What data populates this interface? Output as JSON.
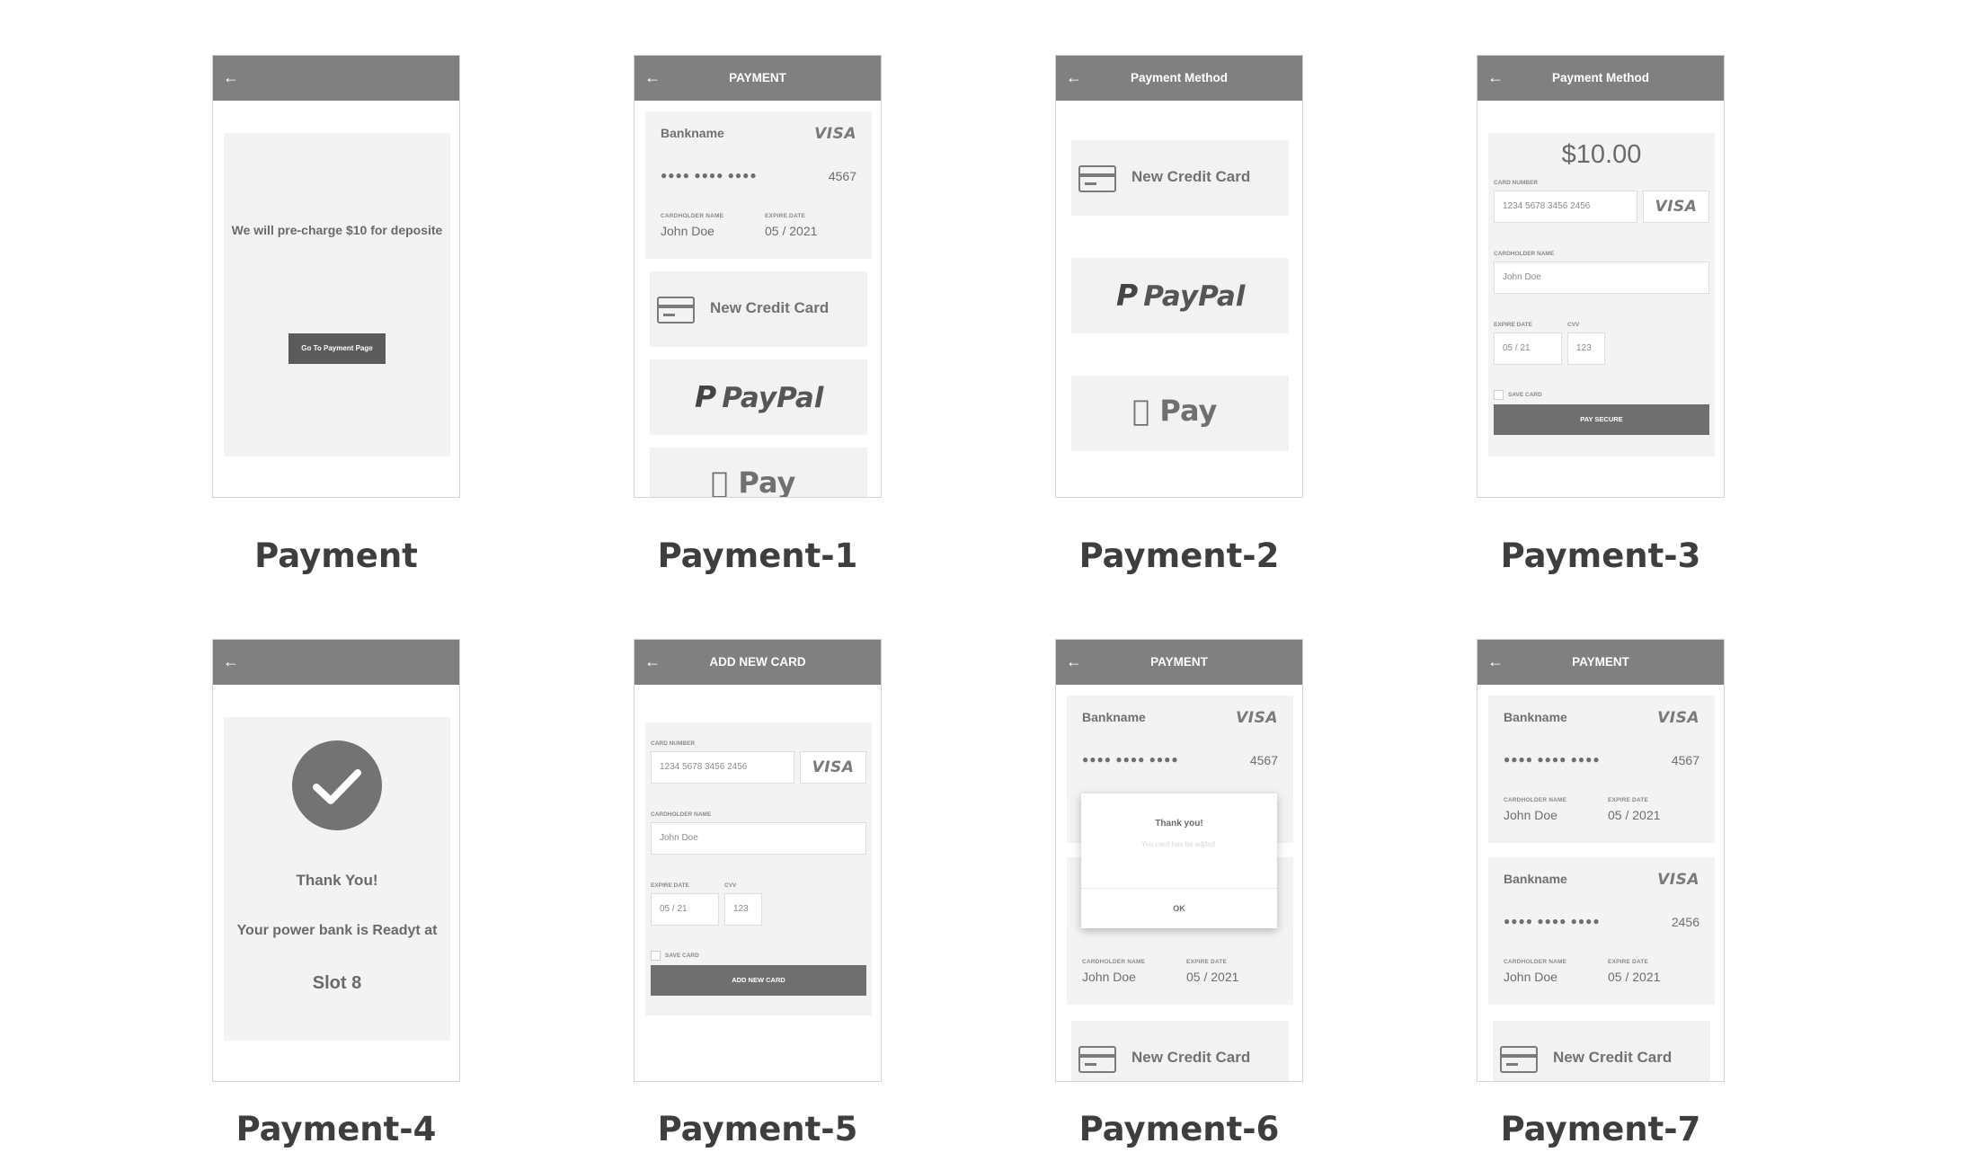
{
  "common": {
    "back_arrow": "←"
  },
  "screens": {
    "s0": {
      "caption": "Payment",
      "title": "",
      "message": "We will pre-charge $10 for deposite",
      "button": "Go To Payment Page"
    },
    "s1": {
      "caption": "Payment-1",
      "title": "PAYMENT",
      "card": {
        "bank": "Bankname",
        "brand": "VISA",
        "dots": "●●●●   ●●●●   ●●●●",
        "last4": "4567",
        "holder_label": "CARDHOLDER NAME",
        "holder": "John Doe",
        "expire_label": "EXPIRE DATE",
        "expire": "05 / 2021"
      },
      "new_card": "New Credit Card",
      "paypal": "PayPal",
      "apple_pay": "Pay"
    },
    "s2": {
      "caption": "Payment-2",
      "title": "Payment Method",
      "new_card": "New Credit Card",
      "paypal": "PayPal",
      "apple_pay": "Pay"
    },
    "s3": {
      "caption": "Payment-3",
      "title": "Payment Method",
      "amount": "$10.00",
      "card_number_label": "CARD NUMBER",
      "card_number": "1234     5678     3456     2456",
      "brand": "VISA",
      "holder_label": "CARDHOLDER NAME",
      "holder": "John Doe",
      "expire_label": "EXPIRE DATE",
      "expire": "05    /    21",
      "cvv_label": "CVV",
      "cvv": "123",
      "save_label": "SAVE CARD",
      "pay_button": "PAY SECURE"
    },
    "s4": {
      "caption": "Payment-4",
      "title": "",
      "thanks": "Thank You!",
      "ready": "Your power bank is Readyt at",
      "slot": "Slot 8"
    },
    "s5": {
      "caption": "Payment-5",
      "title": "ADD NEW CARD",
      "card_number_label": "CARD NUMBER",
      "card_number": "1234     5678     3456     2456",
      "brand": "VISA",
      "holder_label": "CARDHOLDER NAME",
      "holder": "John Doe",
      "expire_label": "EXPIRE DATE",
      "expire": "05    /    21",
      "cvv_label": "CVV",
      "cvv": "123",
      "save_label": "SAVE CARD",
      "add_button": "ADD NEW CARD"
    },
    "s6": {
      "caption": "Payment-6",
      "title": "PAYMENT",
      "card": {
        "bank": "Bankname",
        "brand": "VISA",
        "dots": "●●●●   ●●●●   ●●●●",
        "last4": "4567"
      },
      "card2": {
        "holder_label": "CARDHOLDER NAME",
        "holder": "John Doe",
        "expire_label": "EXPIRE DATE",
        "expire": "05 / 2021"
      },
      "dialog": {
        "title": "Thank you!",
        "message": "You card has be added.",
        "ok": "OK"
      },
      "new_card": "New Credit Card"
    },
    "s7": {
      "caption": "Payment-7",
      "title": "PAYMENT",
      "card1": {
        "bank": "Bankname",
        "brand": "VISA",
        "dots": "●●●●   ●●●●   ●●●●",
        "last4": "4567",
        "holder_label": "CARDHOLDER NAME",
        "holder": "John Doe",
        "expire_label": "EXPIRE DATE",
        "expire": "05 / 2021"
      },
      "card2": {
        "bank": "Bankname",
        "brand": "VISA",
        "dots": "●●●●   ●●●●   ●●●●",
        "last4": "2456",
        "holder_label": "CARDHOLDER NAME",
        "holder": "John Doe",
        "expire_label": "EXPIRE DATE",
        "expire": "05 / 2021"
      },
      "new_card": "New Credit Card"
    }
  }
}
